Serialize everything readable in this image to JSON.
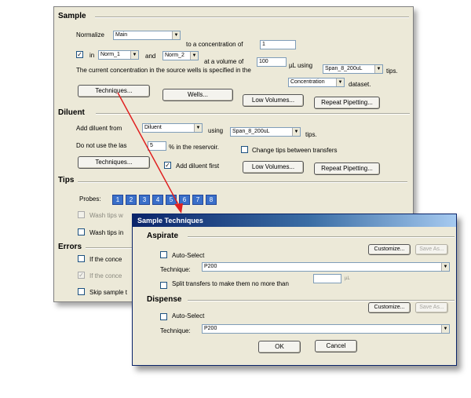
{
  "sample": {
    "heading": "Sample",
    "normalize_label": "Normalize",
    "normalize_value": "Main",
    "to_concentration_label": "to a concentration of",
    "concentration_value": "1",
    "in_label": "in",
    "in_value": "Norm_1",
    "and_label": "and",
    "and_value": "Norm_2",
    "volume_label": "at a volume of",
    "volume_value": "100",
    "using_label": "µL using",
    "tips_value": "Span_8_200uL",
    "tips_label": "tips.",
    "source_text": "The current concentration in the source wells is specified in the",
    "dataset_value": "Concentration",
    "dataset_label": "dataset.",
    "techniques_btn": "Techniques...",
    "wells_btn": "Wells...",
    "low_volumes_btn": "Low Volumes...",
    "repeat_btn": "Repeat Pipetting..."
  },
  "diluent": {
    "heading": "Diluent",
    "add_from_label": "Add diluent from",
    "add_from_value": "Diluent",
    "using_label": "using",
    "tips_value": "Span_8_200uL",
    "tips_label": "tips.",
    "do_not_use_label": "Do not use the las",
    "percent_value": "5",
    "reservoir_label": "% in the reservoir.",
    "change_tips_label": "Change tips between transfers",
    "techniques_btn": "Techniques...",
    "add_first_label": "Add diluent first",
    "low_volumes_btn": "Low Volumes...",
    "repeat_btn": "Repeat Pipetting..."
  },
  "tips": {
    "heading": "Tips",
    "probes_label": "Probes:",
    "probes": [
      "1",
      "2",
      "3",
      "4",
      "5",
      "6",
      "7",
      "8"
    ],
    "wash_label_1": "Wash tips w",
    "wash_label_2": "Wash tips in"
  },
  "errors": {
    "heading": "Errors",
    "item1": "If the conce",
    "item2": "If the conce",
    "item3": "Skip sample t"
  },
  "dialog": {
    "title": "Sample Techniques",
    "aspirate_heading": "Aspirate",
    "auto_select_label": "Auto-Select",
    "customize_btn": "Customize...",
    "save_as_btn": "Save As...",
    "technique_label": "Technique:",
    "aspirate_technique": "P200",
    "split_label": "Split transfers to make them no more than",
    "split_unit": "µL",
    "dispense_heading": "Dispense",
    "dispense_auto_select_label": "Auto-Select",
    "dispense_customize_btn": "Customize...",
    "dispense_save_as_btn": "Save As...",
    "dispense_technique_label": "Technique:",
    "dispense_technique": "P200",
    "ok_btn": "OK",
    "cancel_btn": "Cancel"
  },
  "icons": {
    "checkmark": "check-icon",
    "dropdown": "chevron-down-icon"
  },
  "colors": {
    "window_bg": "#ece9d8",
    "titlebar": "#0a246a",
    "probe_selected": "#3a6fc9",
    "arrow": "#e02020"
  }
}
